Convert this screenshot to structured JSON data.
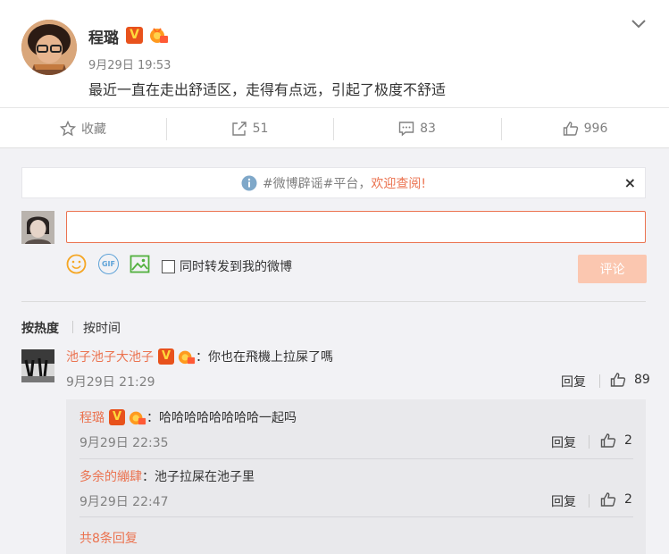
{
  "post": {
    "author": "程璐",
    "time": "9月29日 19:53",
    "text": "最近一直在走出舒适区，走得有点远，引起了极度不舒适",
    "verified_badge": "V"
  },
  "actions": {
    "favorite_label": "收藏",
    "repost_count": "51",
    "comment_count": "83",
    "like_count": "996"
  },
  "notice": {
    "prefix": "#微博辟谣#平台，",
    "link": "欢迎查阅!",
    "close": "×"
  },
  "composer": {
    "placeholder": "",
    "forward_label": "同时转发到我的微博",
    "submit_label": "评论",
    "gif_label": "GIF"
  },
  "sort": {
    "hot": "按热度",
    "time": "按时间"
  },
  "comments": [
    {
      "user": "池子池子大池子",
      "text": "：你也在飛機上拉屎了嗎",
      "time": "9月29日 21:29",
      "reply_label": "回复",
      "likes": "89"
    }
  ],
  "replies": [
    {
      "user": "程璐",
      "text": "：哈哈哈哈哈哈哈哈一起吗",
      "time": "9月29日 22:35",
      "reply_label": "回复",
      "likes": "2"
    },
    {
      "user": "多余的繃肆",
      "text": "：池子拉屎在池子里",
      "time": "9月29日 22:47",
      "reply_label": "回复",
      "likes": "2"
    }
  ],
  "more_replies": "共8条回复",
  "colors": {
    "accent": "#eb7350",
    "submit_disabled": "#fbc7b0",
    "background": "#f2f2f5",
    "verified": "#e8521c"
  },
  "icons": [
    "chevron-down-icon",
    "star-icon",
    "repost-icon",
    "comment-icon",
    "like-icon",
    "info-icon",
    "emoji-icon",
    "gif-icon",
    "image-icon",
    "medal-icon"
  ]
}
